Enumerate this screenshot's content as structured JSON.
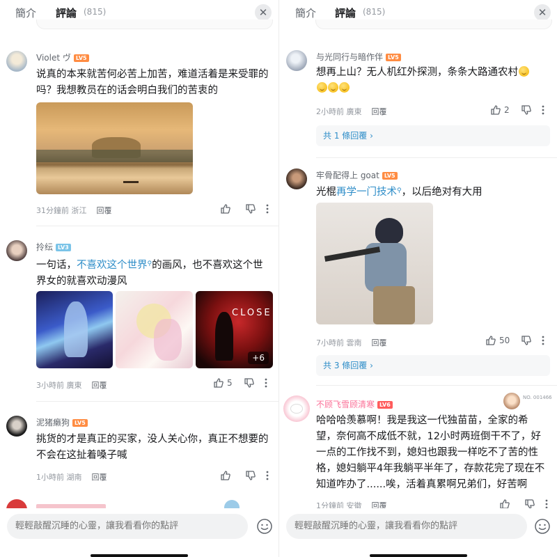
{
  "left": {
    "tabs": {
      "intro": "簡介",
      "comments": "評論",
      "count": "(815)"
    },
    "close_icon": "✕",
    "comments": [
      {
        "user": "Violet ヴ",
        "level": "LV5",
        "text": "说真的本来就苦何必苦上加苦，难道活着是来受罪的吗？我想教员在的话会明白我们的苦衷的",
        "time": "31分鐘前",
        "loc": "浙江",
        "reply": "回覆"
      },
      {
        "user": "拎纭",
        "level": "LV3",
        "text_pre": "一句话，",
        "link": "不喜欢这个世界",
        "text_post": "的画风，也不喜欢这个世界女的就喜欢动漫风",
        "time": "3小時前",
        "loc": "廣東",
        "reply": "回覆",
        "likes": "5",
        "more": "+6",
        "img3_text": "CLOSE"
      },
      {
        "user": "泥猪癞狗",
        "level": "LV5",
        "text": "挑货的才是真正的买家，没人关心你，真正不想要的不会在这扯着嗓子喊",
        "time": "1小時前",
        "loc": "湖南",
        "reply": "回覆"
      }
    ],
    "input_placeholder": "輕輕敲醒沉睡的心靈，讓我看看你的點評"
  },
  "right": {
    "tabs": {
      "intro": "簡介",
      "comments": "評論",
      "count": "(815)"
    },
    "close_icon": "✕",
    "comments": [
      {
        "user": "与光同行与暗作伴",
        "level": "LV5",
        "text": "想再上山？无人机红外探测，条条大路通农村",
        "time": "2小時前",
        "loc": "廣東",
        "reply": "回覆",
        "likes": "2",
        "thread": "共 1 條回覆"
      },
      {
        "user": "牢骨配得上 goat",
        "level": "LV5",
        "text_pre": "光棍",
        "link": "再学一门技术",
        "text_post": "，以后绝对有大用",
        "time": "7小時前",
        "loc": "雲南",
        "reply": "回覆",
        "likes": "50",
        "thread": "共 3 條回覆"
      },
      {
        "user": "不顾飞雪顾清寒",
        "level": "LV6",
        "badge": "NO. 001466",
        "text": "哈哈哈羡慕啊！我是我这一代独苗苗，全家的希望，奈何高不成低不就，12小时两班倒干不了，好一点的工作找不到，媳妇也跟我一样吃不了苦的性格，媳妇躺平4年我躺平半年了，存款花完了现在不知道咋办了......唉，活着真累啊兄弟们，好苦啊",
        "time": "1分鐘前",
        "loc": "安徽",
        "reply": "回覆"
      }
    ],
    "input_placeholder": "輕輕敲醒沉睡的心靈，讓我看看你的點評"
  },
  "colors": {
    "accent": "#fb7299",
    "link": "#2e8dc8",
    "lv3": "#7bc4e8",
    "lv5": "#ff8c42",
    "lv6": "#ff5c5c"
  }
}
